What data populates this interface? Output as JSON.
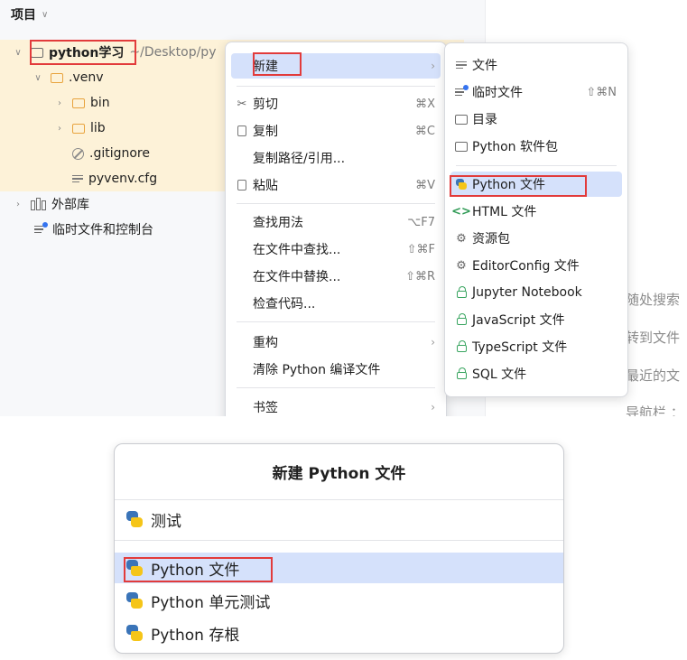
{
  "project_panel": {
    "title": "项目",
    "root": {
      "name": "python学习",
      "path": "~/Desktop/py"
    },
    "items": [
      {
        "name": ".venv"
      },
      {
        "name": "bin"
      },
      {
        "name": "lib"
      },
      {
        "name": ".gitignore"
      },
      {
        "name": "pyvenv.cfg"
      },
      {
        "name": "外部库"
      },
      {
        "name": "临时文件和控制台"
      }
    ]
  },
  "editor_hints": [
    "随处搜索",
    "转到文件",
    "最近的文",
    "导航栏 ："
  ],
  "context_menu": {
    "items": [
      {
        "label": "新建",
        "shortcut": "",
        "submenu": true,
        "icon": ""
      },
      {
        "label": "剪切",
        "shortcut": "⌘X",
        "icon": "scissors-icon"
      },
      {
        "label": "复制",
        "shortcut": "⌘C",
        "icon": "copy-icon"
      },
      {
        "label": "复制路径/引用...",
        "shortcut": "",
        "icon": ""
      },
      {
        "label": "粘贴",
        "shortcut": "⌘V",
        "icon": "paste-icon"
      },
      {
        "label": "查找用法",
        "shortcut": "⌥F7",
        "icon": ""
      },
      {
        "label": "在文件中查找...",
        "shortcut": "⇧⌘F",
        "icon": ""
      },
      {
        "label": "在文件中替换...",
        "shortcut": "⇧⌘R",
        "icon": ""
      },
      {
        "label": "检查代码...",
        "shortcut": "",
        "icon": ""
      },
      {
        "label": "重构",
        "shortcut": "",
        "submenu": true,
        "icon": ""
      },
      {
        "label": "清除 Python 编译文件",
        "shortcut": "",
        "icon": ""
      },
      {
        "label": "书签",
        "shortcut": "",
        "submenu": true,
        "icon": ""
      }
    ]
  },
  "new_submenu": {
    "items": [
      {
        "label": "文件",
        "shortcut": ""
      },
      {
        "label": "临时文件",
        "shortcut": "⇧⌘N"
      },
      {
        "label": "目录",
        "shortcut": ""
      },
      {
        "label": "Python 软件包",
        "shortcut": ""
      },
      {
        "label": "Python 文件",
        "shortcut": ""
      },
      {
        "label": "HTML 文件",
        "shortcut": ""
      },
      {
        "label": "资源包",
        "shortcut": ""
      },
      {
        "label": "EditorConfig 文件",
        "shortcut": ""
      },
      {
        "label": "Jupyter Notebook",
        "shortcut": ""
      },
      {
        "label": "JavaScript 文件",
        "shortcut": ""
      },
      {
        "label": "TypeScript 文件",
        "shortcut": ""
      },
      {
        "label": "SQL 文件",
        "shortcut": ""
      }
    ]
  },
  "dialog": {
    "title": "新建 Python 文件",
    "input_value": "测试",
    "options": [
      "Python 文件",
      "Python 单元测试",
      "Python 存根"
    ]
  },
  "colors": {
    "selection": "#d5e1fb",
    "highlight_row": "#fdf2d8",
    "annotation_box": "#e23b3b",
    "folder": "#e8a33d"
  }
}
